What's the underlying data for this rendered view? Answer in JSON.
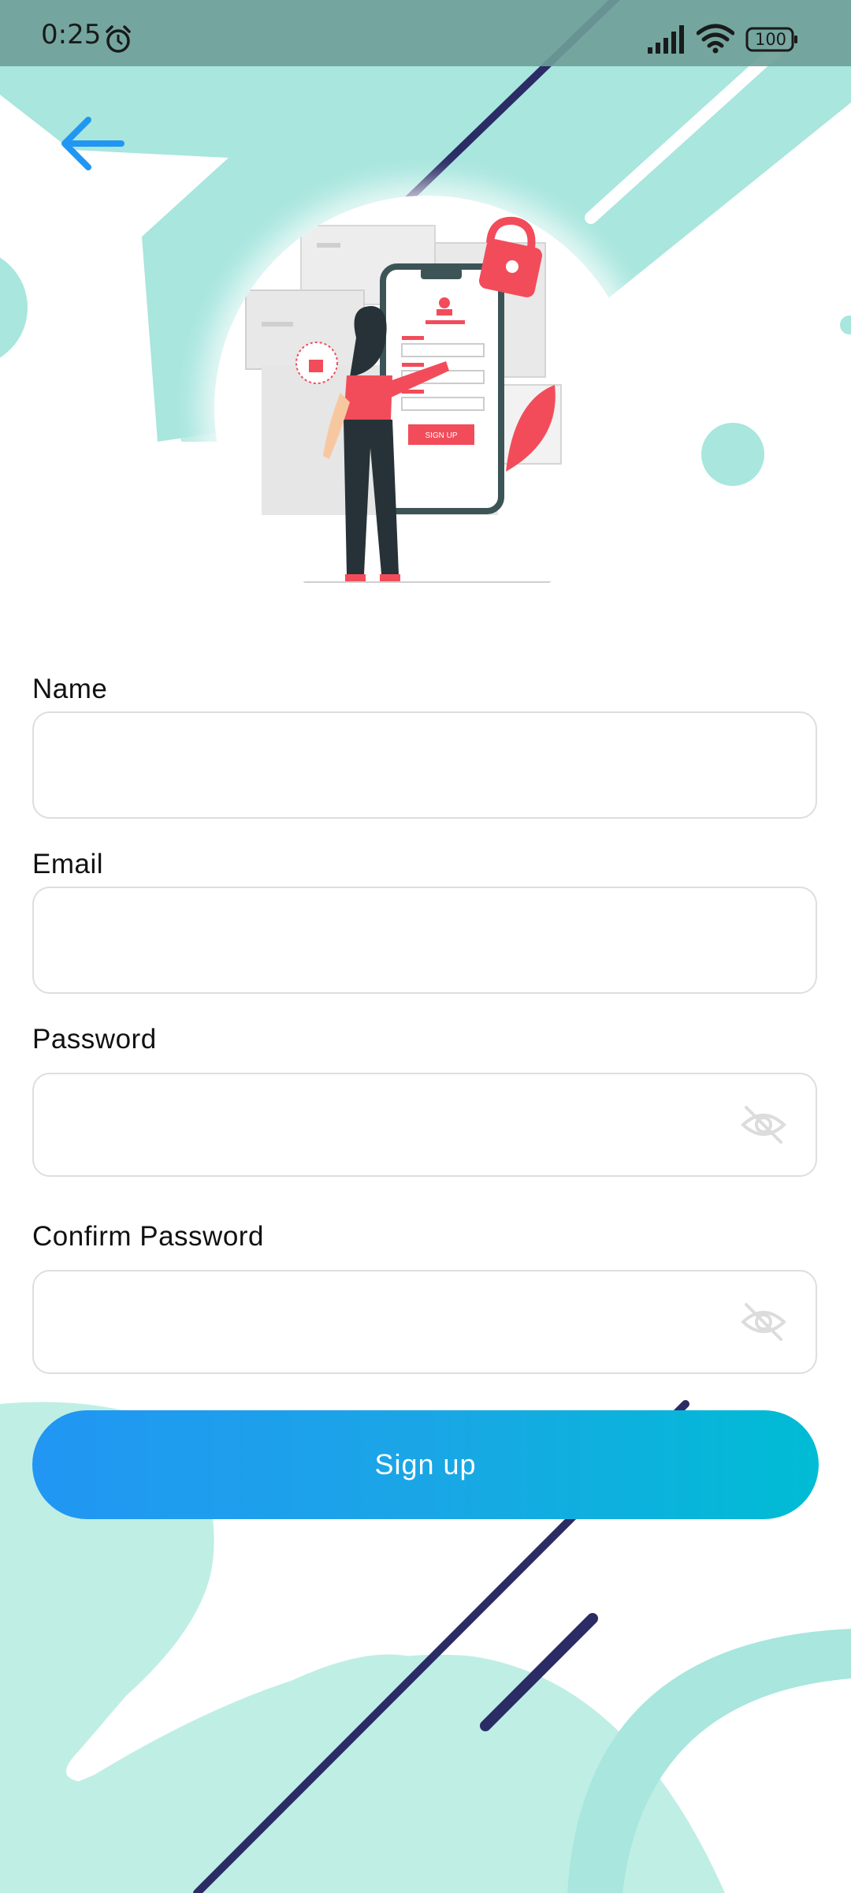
{
  "status_bar": {
    "time": "0:25",
    "battery": "100",
    "alarm_icon": "alarm-clock-icon",
    "signal_icon": "cellular-signal-icon",
    "wifi_icon": "wifi-icon",
    "battery_icon": "battery-icon"
  },
  "header": {
    "back_icon": "arrow-left-icon"
  },
  "illustration": {
    "button_text": "SIGN UP"
  },
  "form": {
    "fields": [
      {
        "label": "Name",
        "value": "",
        "placeholder": ""
      },
      {
        "label": "Email",
        "value": "",
        "placeholder": ""
      },
      {
        "label": "Password",
        "value": "",
        "placeholder": "",
        "icon": "eye-off-icon"
      },
      {
        "label": "Confirm Password",
        "value": "",
        "placeholder": "",
        "icon": "eye-off-icon"
      }
    ],
    "submit_label": "Sign up"
  },
  "colors": {
    "accent_start": "#2196f3",
    "accent_end": "#00bcd4",
    "back_arrow": "#2196f3",
    "teal_shape": "#a8e6de",
    "navy_line": "#2b2b66",
    "illustration_red": "#f24c5a"
  }
}
